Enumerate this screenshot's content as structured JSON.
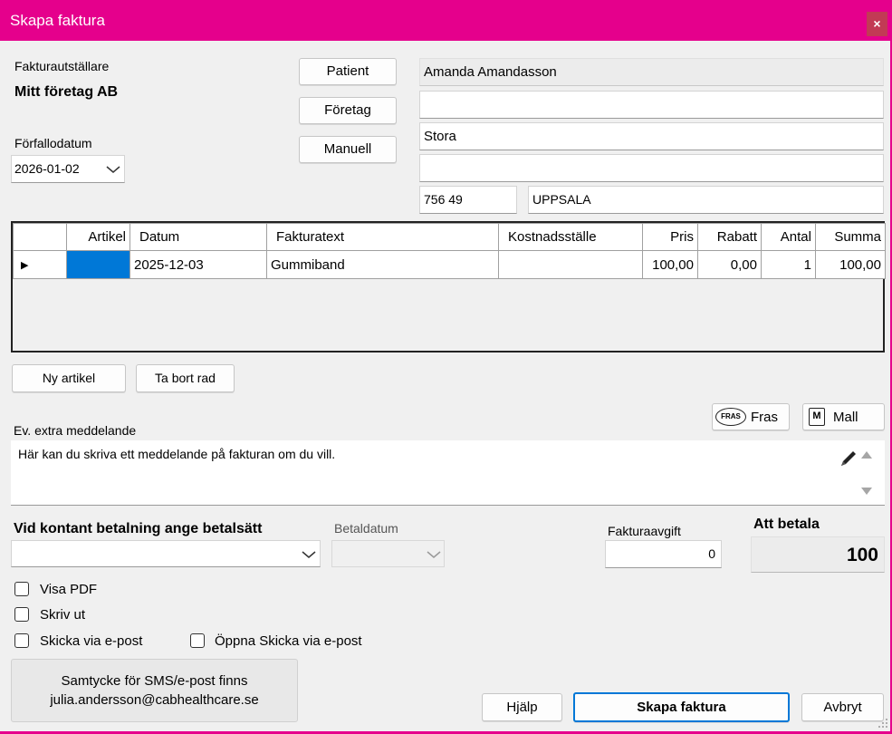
{
  "window": {
    "title": "Skapa faktura",
    "close_glyph": "×"
  },
  "issuer": {
    "label": "Fakturautställare",
    "name": "Mitt företag AB"
  },
  "due_date": {
    "label": "Förfallodatum",
    "value": "2026-01-02"
  },
  "recipient_buttons": {
    "patient": "Patient",
    "company": "Företag",
    "manual": "Manuell"
  },
  "address": {
    "name": "Amanda Amandasson",
    "line2": "",
    "line3": "Stora",
    "line4": "",
    "postal_code": "756 49",
    "city": "UPPSALA"
  },
  "grid": {
    "headers": [
      "",
      "Artikel",
      "Datum",
      "Fakturatext",
      "Kostnadsställe",
      "Pris",
      "Rabatt",
      "Antal",
      "Summa"
    ],
    "rows": [
      {
        "marker": "▶",
        "artikel": "",
        "datum": "2025-12-03",
        "fakturatext": "Gummiband",
        "kostnadsstalle": "",
        "pris": "100,00",
        "rabatt": "0,00",
        "antal": "1",
        "summa": "100,00"
      }
    ]
  },
  "row_buttons": {
    "new_article": "Ny artikel",
    "remove_row": "Ta bort rad"
  },
  "message": {
    "label": "Ev. extra meddelande",
    "text": "Här kan du skriva ett meddelande på fakturan om du vill.",
    "fras_button": "Fras",
    "fras_icon_text": "FRAS",
    "mall_button": "Mall",
    "mall_icon_text": "M"
  },
  "payment": {
    "method_label": "Vid kontant betalning ange betalsätt",
    "method_value": "",
    "date_label": "Betaldatum",
    "date_value": "",
    "fee_label": "Fakturaavgift",
    "fee_value": "0",
    "total_label": "Att betala",
    "total_value": "100"
  },
  "options": {
    "show_pdf": {
      "label": "Visa PDF",
      "checked": false
    },
    "print": {
      "label": "Skriv ut",
      "checked": false
    },
    "send_email": {
      "label": "Skicka via e-post",
      "checked": false
    },
    "open_send_email": {
      "label": "Öppna Skicka via e-post",
      "checked": false
    }
  },
  "consent": {
    "line1": "Samtycke för SMS/e-post finns",
    "line2": "julia.andersson@cabhealthcare.se"
  },
  "footer": {
    "help": "Hjälp",
    "create": "Skapa faktura",
    "cancel": "Avbryt"
  },
  "colors": {
    "accent": "#e5008c",
    "selection": "#0078d7",
    "close_bg": "#c23a55"
  }
}
